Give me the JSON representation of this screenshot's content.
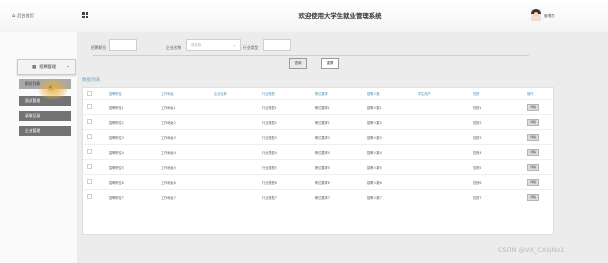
{
  "header": {
    "home_label": "后台首页",
    "app_title": "欢迎使用大学生就业管理系统",
    "user_name": "管理员"
  },
  "sidebar": {
    "group_label": "招聘管理",
    "items": [
      {
        "label": "职位列表",
        "active": true
      },
      {
        "label": "面试管理",
        "active": false
      },
      {
        "label": "录取记录",
        "active": false
      },
      {
        "label": "企业管理",
        "active": false
      }
    ]
  },
  "filters": {
    "position_label": "招聘职位",
    "position_value": "",
    "company_label": "企业名称",
    "company_placeholder": "请选择",
    "industry_label": "行业类型",
    "industry_value": "",
    "query_button": "查询",
    "reset_button": "重置"
  },
  "table": {
    "section_title": "数据列表",
    "columns": [
      "招聘职位",
      "工作地址",
      "企业名称",
      "行业类型",
      "职位要求",
      "招聘人数",
      "学生用户",
      "性别",
      "操作"
    ],
    "rows": [
      [
        "招聘职位1",
        "工作地址1",
        "",
        "行业类型1",
        "职位要求1",
        "招聘人数1",
        "",
        "性别1",
        "详情"
      ],
      [
        "招聘职位2",
        "工作地址2",
        "",
        "行业类型2",
        "职位要求2",
        "招聘人数2",
        "",
        "性别2",
        "详情"
      ],
      [
        "招聘职位3",
        "工作地址3",
        "",
        "行业类型3",
        "职位要求3",
        "招聘人数3",
        "",
        "性别3",
        "详情"
      ],
      [
        "招聘职位4",
        "工作地址4",
        "",
        "行业类型4",
        "职位要求4",
        "招聘人数4",
        "",
        "性别4",
        "详情"
      ],
      [
        "招聘职位5",
        "工作地址5",
        "",
        "行业类型5",
        "职位要求5",
        "招聘人数5",
        "",
        "性别5",
        "详情"
      ],
      [
        "招聘职位6",
        "工作地址6",
        "",
        "行业类型6",
        "职位要求6",
        "招聘人数6",
        "",
        "性别6",
        "详情"
      ],
      [
        "招聘职位7",
        "工作地址7",
        "",
        "行业类型7",
        "职位要求7",
        "招聘人数7",
        "",
        "性别7",
        "详情"
      ]
    ]
  },
  "watermark": "CSDN @VX_CXsjNo1",
  "icons": {
    "home": "home-icon",
    "menu_grid": "grid-icon",
    "group": "grid-small-icon",
    "chevron": "chevron-down-icon",
    "avatar": "user-avatar"
  }
}
